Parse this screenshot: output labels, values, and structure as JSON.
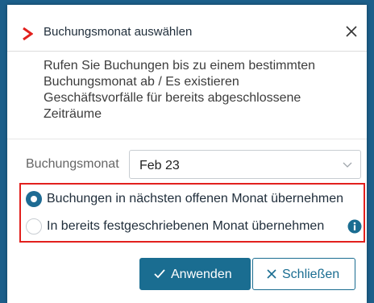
{
  "dialog": {
    "title": "Buchungsmonat auswählen",
    "message_lines": [
      "Rufen Sie Buchungen bis zu einem bestimmten",
      "Buchungsmonat ab / Es existieren",
      "Geschäftsvorfälle für bereits abgeschlossene",
      "Zeiträume"
    ],
    "field": {
      "label": "Buchungsmonat",
      "selected_value": "Feb 23"
    },
    "options": [
      {
        "label": "Buchungen in nächsten offenen Monat übernehmen",
        "checked": true
      },
      {
        "label": "In bereits festgeschriebenen Monat übernehmen",
        "checked": false
      }
    ],
    "buttons": {
      "apply_label": "Anwenden",
      "close_label": "Schließen"
    }
  },
  "colors": {
    "accent": "#1a6d91",
    "chevron": "#e2201d",
    "highlight_border": "#e2201d",
    "backdrop": "#1c5f8a"
  },
  "icons": {
    "title": "chevron-right-icon",
    "close": "close-icon",
    "dropdown": "chevron-down-icon",
    "info": "info-icon",
    "apply": "check-icon",
    "dismiss": "x-icon"
  }
}
